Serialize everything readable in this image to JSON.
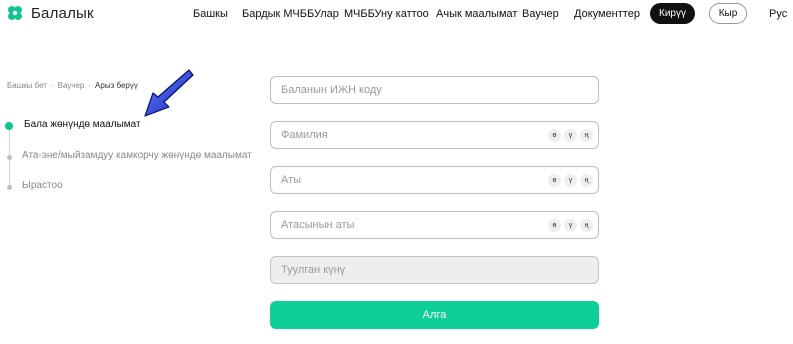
{
  "brand": {
    "name": "Балалык",
    "logo_icon": "clover-icon",
    "accent": "#11c48f"
  },
  "nav": {
    "items": [
      "Башкы",
      "Бардык МЧББУлар",
      "МЧББУну каттоо",
      "Ачык маалымат",
      "Ваучер",
      "Документтер"
    ],
    "login_label": "Кирүү",
    "lang_ky_label": "Кыр",
    "lang_ru_label": "Рус"
  },
  "breadcrumb": {
    "items": [
      "Башкы бет",
      "Ваучер",
      "Арыз берүү"
    ],
    "separator": "·"
  },
  "steps": [
    {
      "label": "Бала жөнүндө маалымат",
      "active": true
    },
    {
      "label": "Ата-эне/мыйзамдуу камкорчу жөнүндө маалымат",
      "active": false
    },
    {
      "label": "Ырастоо",
      "active": false
    }
  ],
  "form": {
    "fields": [
      {
        "placeholder": "Баланын ИЖН коду",
        "keyboard": [],
        "disabled": false
      },
      {
        "placeholder": "Фамилия",
        "keyboard": [
          "ө",
          "ү",
          "ң"
        ],
        "disabled": false
      },
      {
        "placeholder": "Аты",
        "keyboard": [
          "ө",
          "ү",
          "ң"
        ],
        "disabled": false
      },
      {
        "placeholder": "Атасынын аты",
        "keyboard": [
          "ө",
          "ү",
          "ң"
        ],
        "disabled": false
      },
      {
        "placeholder": "Туулган күнү",
        "keyboard": [],
        "disabled": true
      }
    ],
    "submit_label": "Алга",
    "submit_color": "#0fcf98"
  },
  "annotation": {
    "icon": "blue-arrow-icon",
    "color": "#1a2fd1"
  }
}
